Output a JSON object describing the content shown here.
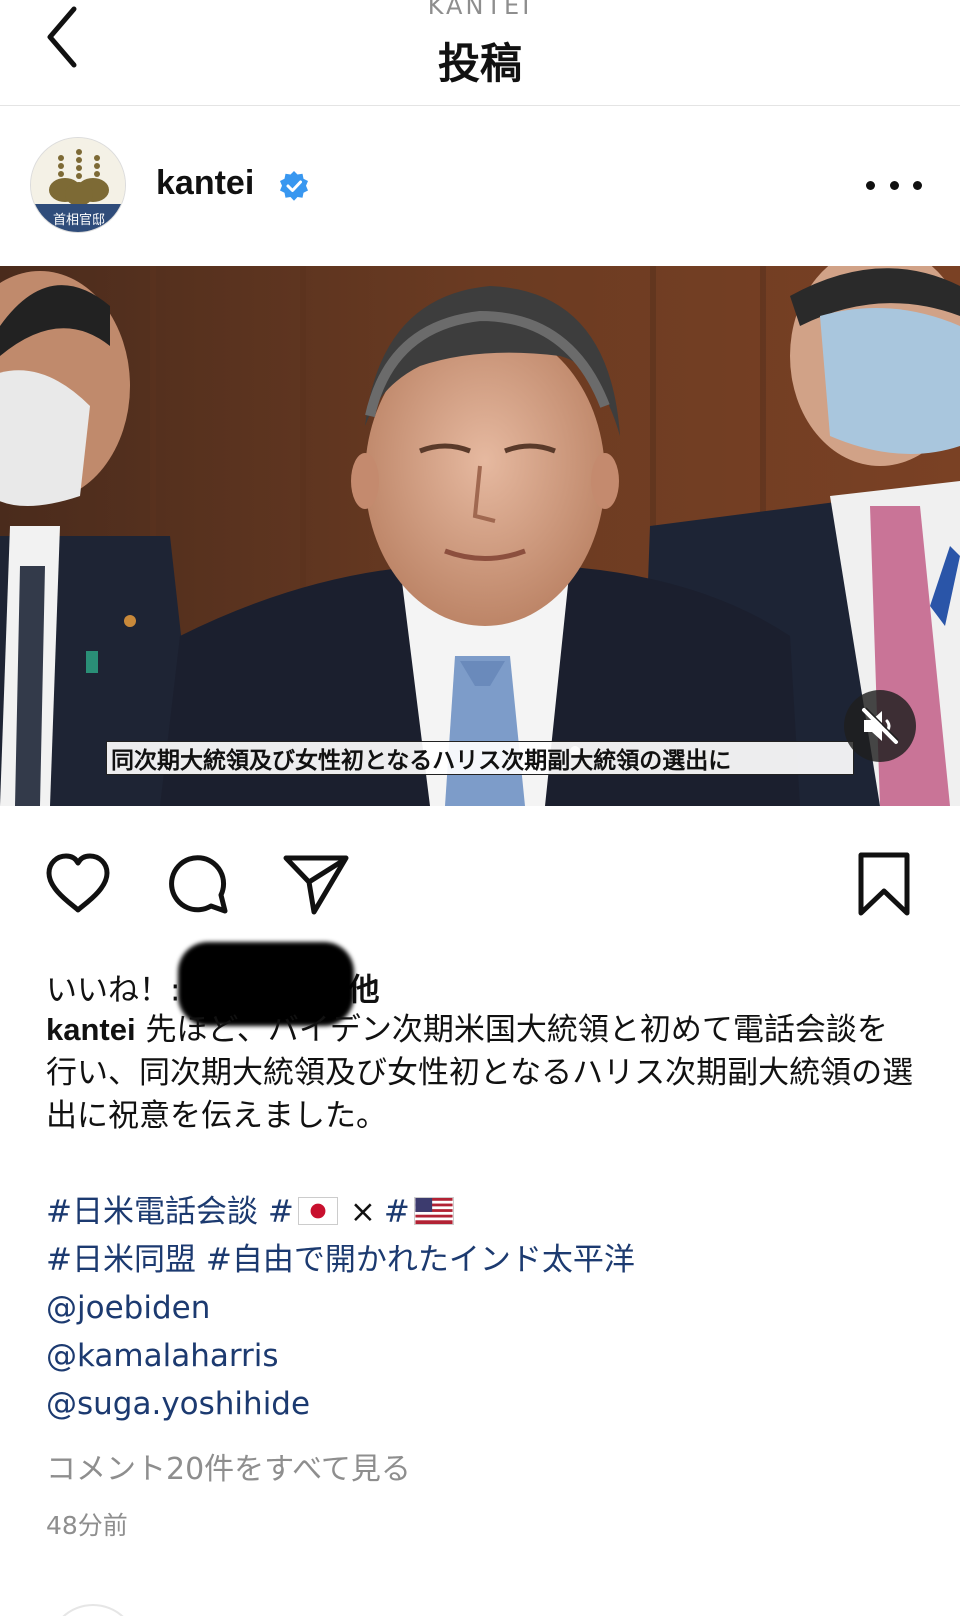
{
  "header": {
    "subtitle": "KANTEI",
    "title": "投稿",
    "back_icon": "chevron-left-icon"
  },
  "post": {
    "avatar_text": "首相官邸",
    "username": "kantei",
    "verified_icon": "verified-badge-icon",
    "more_icon": "more-horizontal-icon",
    "video_subtitle": "同次期大統領及び女性初となるハリス次期副大統領の選出に",
    "mute_icon": "volume-muted-icon"
  },
  "actions": {
    "like_icon": "heart-icon",
    "comment_icon": "comment-bubble-icon",
    "share_icon": "paper-plane-icon",
    "save_icon": "bookmark-icon"
  },
  "likes": {
    "prefix": "いいね！:",
    "suffix": "他"
  },
  "caption": {
    "username": "kantei",
    "text": " 先ほど、バイデン次期米国大統領と初めて電話会談を行い、同次期大統領及び女性初となるハリス次期副大統領の選出に祝意を伝えました。"
  },
  "hashtags": {
    "tag1": "#日米電話会談",
    "tag2_prefix": "#",
    "flag1": "japan-flag-icon",
    "times": "×",
    "tag3_prefix": "#",
    "flag2": "us-flag-icon",
    "tag4": "#日米同盟",
    "tag5": "#自由で開かれたインド太平洋",
    "mention1": "@joebiden",
    "mention2": "@kamalaharris",
    "mention3": "@suga.yoshihide"
  },
  "footer": {
    "comments_link": "コメント20件をすべて見る",
    "timestamp": "48分前"
  },
  "colors": {
    "link": "#1c3a70",
    "verified": "#3897f0",
    "muted_text": "#8e8e8e"
  }
}
